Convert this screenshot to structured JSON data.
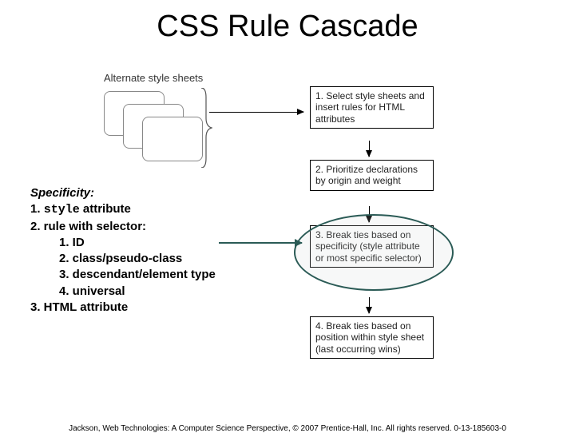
{
  "title": "CSS Rule Cascade",
  "altLabel": "Alternate style sheets",
  "steps": {
    "s1": "1. Select style sheets and insert rules for HTML attributes",
    "s2": "2. Prioritize declarations by origin and weight",
    "s3": "3. Break ties based on specificity (style attribute or most specific selector)",
    "s4": "4. Break ties based on position within style sheet (last occurring wins)"
  },
  "specificity": {
    "heading": "Specificity",
    "item1_prefix": "1. ",
    "item1_code": "style",
    "item1_suffix": " attribute",
    "item2": "2.  rule with selector:",
    "sub1": "1.  ID",
    "sub2": "2.  class/pseudo-class",
    "sub3": "3.  descendant/element type",
    "sub4": "4.  universal",
    "item3": "3.  HTML attribute"
  },
  "footer": "Jackson, Web Technologies: A Computer Science Perspective, © 2007 Prentice-Hall, Inc. All rights reserved. 0-13-185603-0"
}
